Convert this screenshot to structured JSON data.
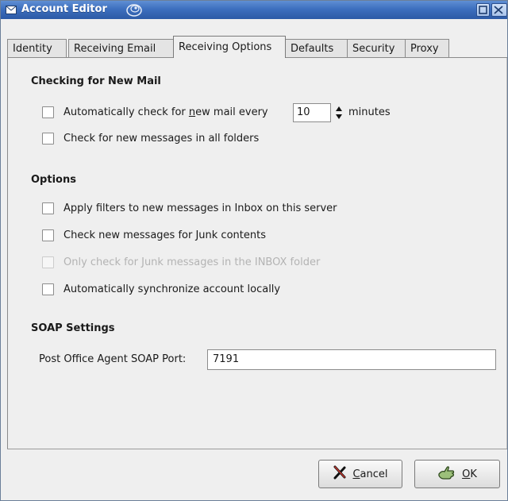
{
  "window": {
    "title": "Account Editor",
    "icons": {
      "title": "envelope-icon",
      "swirl": "spinner-swirl-icon",
      "maximize": "maximize-icon",
      "close": "close-icon"
    }
  },
  "tabs": [
    {
      "label": "Identity"
    },
    {
      "label": "Receiving Email"
    },
    {
      "label": "Receiving Options",
      "active": true
    },
    {
      "label": "Defaults"
    },
    {
      "label": "Security"
    },
    {
      "label": "Proxy"
    }
  ],
  "checking": {
    "title": "Checking for New Mail",
    "auto_check": {
      "pre": "Automatically check for ",
      "mnemonic": "n",
      "post": "ew mail every",
      "checked": false
    },
    "interval_value": "10",
    "interval_unit": "minutes",
    "all_folders": {
      "label": "Check for new messages in all folders",
      "checked": false
    }
  },
  "options": {
    "title": "Options",
    "items": [
      {
        "label": "Apply filters to new messages in Inbox on this server",
        "checked": false,
        "disabled": false
      },
      {
        "label": "Check new messages for Junk contents",
        "checked": false,
        "disabled": false
      },
      {
        "label": "Only check for Junk messages in the INBOX folder",
        "checked": false,
        "disabled": true
      },
      {
        "label": "Automatically synchronize account locally",
        "checked": false,
        "disabled": false
      }
    ]
  },
  "soap": {
    "title": "SOAP Settings",
    "port_label": "Post Office Agent SOAP Port:",
    "port_value": "7191"
  },
  "buttons": {
    "cancel": {
      "mnemonic": "C",
      "rest": "ancel",
      "icon": "cancel-x-icon"
    },
    "ok": {
      "mnemonic": "O",
      "rest": "K",
      "icon": "ok-hand-icon"
    }
  },
  "colors": {
    "titlebar": "#3d6fbe",
    "background": "#efefef"
  }
}
